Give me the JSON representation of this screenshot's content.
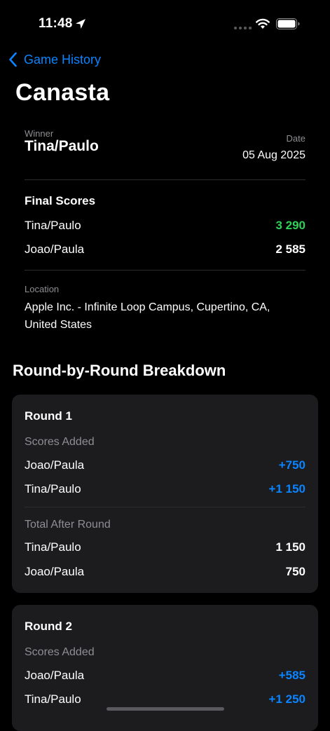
{
  "status_bar": {
    "time": "11:48"
  },
  "nav": {
    "back_label": "Game History"
  },
  "page_title": "Canasta",
  "summary": {
    "winner_label": "Winner",
    "winner_value": "Tina/Paulo",
    "date_label": "Date",
    "date_value": "05 Aug 2025",
    "final_scores_heading": "Final Scores",
    "final_scores": [
      {
        "team": "Tina/Paulo",
        "score": "3 290",
        "color": "#30d158"
      },
      {
        "team": "Joao/Paula",
        "score": "2 585",
        "color": "#ffffff"
      }
    ],
    "location_label": "Location",
    "location_value": "Apple Inc. - Infinite Loop Campus, Cupertino, CA, United States"
  },
  "breakdown": {
    "heading": "Round-by-Round Breakdown",
    "rounds": [
      {
        "title": "Round 1",
        "scores_added_label": "Scores Added",
        "scores_added": [
          {
            "team": "Joao/Paula",
            "value": "+750"
          },
          {
            "team": "Tina/Paulo",
            "value": "+1 150"
          }
        ],
        "total_label": "Total After Round",
        "totals": [
          {
            "team": "Tina/Paulo",
            "value": "1 150"
          },
          {
            "team": "Joao/Paula",
            "value": "750"
          }
        ]
      },
      {
        "title": "Round 2",
        "scores_added_label": "Scores Added",
        "scores_added": [
          {
            "team": "Joao/Paula",
            "value": "+585"
          },
          {
            "team": "Tina/Paulo",
            "value": "+1 250"
          }
        ]
      }
    ]
  },
  "colors": {
    "accent": "#0a84ff",
    "winner_score": "#30d158",
    "card_background": "#1c1c1e",
    "background": "#000000"
  },
  "icons": [
    "location-arrow-icon",
    "wifi-icon",
    "battery-icon",
    "chevron-left-icon"
  ]
}
